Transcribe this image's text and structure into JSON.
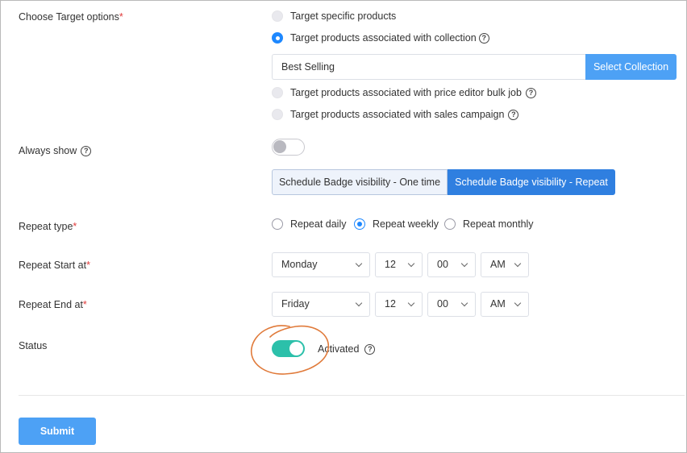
{
  "target": {
    "label": "Choose Target options",
    "required_mark": "*",
    "options": [
      {
        "label": "Target specific products",
        "state": "unselected"
      },
      {
        "label": "Target products associated with collection",
        "state": "selected",
        "help": "?"
      },
      {
        "label": "Target products associated with price editor bulk job",
        "state": "unselected",
        "help": "?"
      },
      {
        "label": "Target products associated with sales campaign",
        "state": "unselected",
        "help": "?"
      }
    ],
    "collection_value": "Best Selling",
    "select_collection_label": "Select Collection"
  },
  "always_show": {
    "label": "Always show",
    "help": "?",
    "enabled": false
  },
  "schedule": {
    "one_time_label": "Schedule Badge visibility - One time",
    "repeat_label": "Schedule Badge visibility - Repeat",
    "active": "repeat"
  },
  "repeat_type": {
    "label": "Repeat type",
    "required_mark": "*",
    "options": [
      {
        "label": "Repeat daily",
        "selected": false
      },
      {
        "label": "Repeat weekly",
        "selected": true
      },
      {
        "label": "Repeat monthly",
        "selected": false
      }
    ]
  },
  "repeat_start": {
    "label": "Repeat Start at",
    "required_mark": "*",
    "day": "Monday",
    "hour": "12",
    "minute": "00",
    "ampm": "AM"
  },
  "repeat_end": {
    "label": "Repeat End at",
    "required_mark": "*",
    "day": "Friday",
    "hour": "12",
    "minute": "00",
    "ampm": "AM"
  },
  "status": {
    "label": "Status",
    "value": "Activated",
    "help": "?",
    "enabled": true,
    "annotation_color": "#e07a3a"
  },
  "submit_label": "Submit",
  "colors": {
    "primary": "#4da1f5",
    "active_segment": "#2f7fe0",
    "toggle_on": "#2cc0aa",
    "required": "#e03a3a"
  }
}
